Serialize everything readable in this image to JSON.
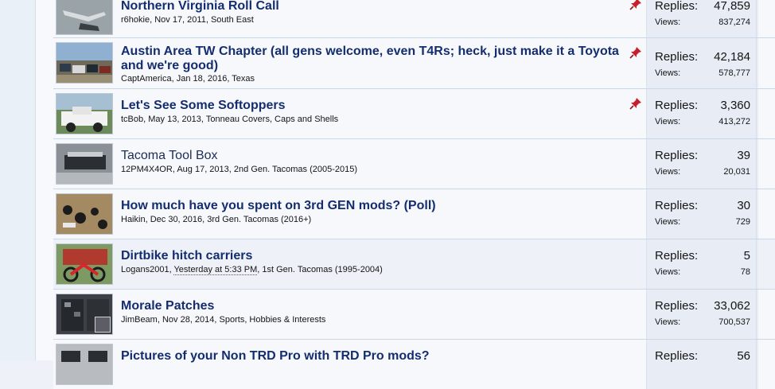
{
  "threads": [
    {
      "title": "Northern Virginia Roll Call",
      "author": "r6hokie",
      "date": "Nov 17, 2011",
      "forum": "South East",
      "replies_label": "Replies:",
      "replies": "47,859",
      "views_label": "Views:",
      "views": "837,274",
      "sticky": true,
      "icon": "thumbnail-knife"
    },
    {
      "title": "Austin Area TW Chapter (all gens welcome, even T4Rs; heck, just make it a Toyota and we're good)",
      "author": "CaptAmerica",
      "date": "Jan 18, 2016",
      "forum": "Texas",
      "replies_label": "Replies:",
      "replies": "42,184",
      "views_label": "Views:",
      "views": "578,777",
      "sticky": true,
      "icon": "thumbnail-trucks"
    },
    {
      "title": "Let's See Some Softoppers",
      "author": "tcBob",
      "date": "May 13, 2013",
      "forum": "Tonneau Covers, Caps and Shells",
      "replies_label": "Replies:",
      "replies": "3,360",
      "views_label": "Views:",
      "views": "413,272",
      "sticky": true,
      "icon": "thumbnail-white-truck"
    },
    {
      "title": "Tacoma Tool Box",
      "author": "12PM4X4OR",
      "date": "Aug 17, 2013",
      "forum": "2nd Gen. Tacomas (2005-2015)",
      "replies_label": "Replies:",
      "replies": "39",
      "views_label": "Views:",
      "views": "20,031",
      "sticky": false,
      "icon": "thumbnail-toolbox"
    },
    {
      "title": "How much have you spent on 3rd GEN mods? (Poll)",
      "author": "Haikin",
      "date": "Dec 30, 2016",
      "forum": "3rd Gen. Tacomas (2016+)",
      "replies_label": "Replies:",
      "replies": "30",
      "views_label": "Views:",
      "views": "729",
      "sticky": false,
      "icon": "thumbnail-parts"
    },
    {
      "title": "Dirtbike hitch carriers",
      "author": "Logans2001",
      "date": "Yesterday at 5:33 PM",
      "forum": "1st Gen. Tacomas (1995-2004)",
      "replies_label": "Replies:",
      "replies": "5",
      "views_label": "Views:",
      "views": "78",
      "sticky": false,
      "icon": "thumbnail-dirtbike"
    },
    {
      "title": "Morale Patches",
      "author": "JimBeam",
      "date": "Nov 28, 2014",
      "forum": "Sports, Hobbies & Interests",
      "replies_label": "Replies:",
      "replies": "33,062",
      "views_label": "Views:",
      "views": "700,537",
      "sticky": false,
      "icon": "thumbnail-patches"
    },
    {
      "title": "Pictures of your Non TRD Pro with TRD Pro mods?",
      "author": "",
      "date": "",
      "forum": "",
      "replies_label": "Replies:",
      "replies": "56",
      "views_label": "Views:",
      "views": "",
      "sticky": false,
      "icon": "thumbnail-grille"
    }
  ],
  "colors": {
    "title": "#142d6f",
    "row_border": "#c9d7e6",
    "stats_bg": "#e8edf5",
    "pin": "#c8202a"
  }
}
